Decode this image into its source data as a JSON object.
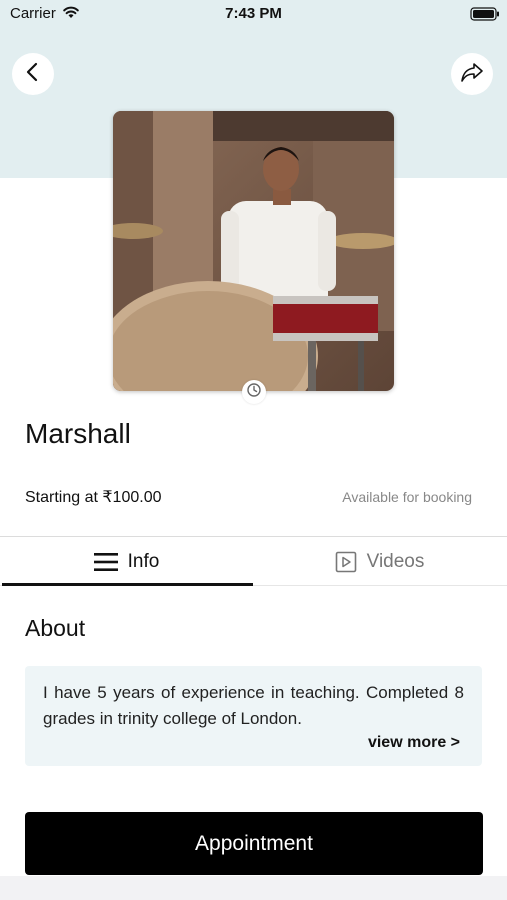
{
  "status_bar": {
    "carrier": "Carrier",
    "time": "7:43 PM",
    "icons": [
      "wifi-icon",
      "battery-icon"
    ]
  },
  "header": {
    "back_icon": "chevron-left-icon",
    "share_icon": "share-arrow-icon",
    "background_color": "#e2eef0"
  },
  "profile": {
    "name": "Marshall",
    "price_label": "Starting at ₹100.00",
    "availability": "Available for booking",
    "photo_icon": "clock-icon"
  },
  "tabs": [
    {
      "label": "Info",
      "icon": "menu-icon",
      "active": true
    },
    {
      "label": "Videos",
      "icon": "play-square-icon",
      "active": false
    }
  ],
  "about": {
    "title": "About",
    "text": "I have 5 years of experience in teaching. Completed 8 grades in trinity college of London.",
    "view_more": "view more >"
  },
  "actions": {
    "appointment_label": "Appointment"
  },
  "colors": {
    "accent": "#000000",
    "card_bg": "#eef5f7",
    "muted_text": "#888888"
  }
}
